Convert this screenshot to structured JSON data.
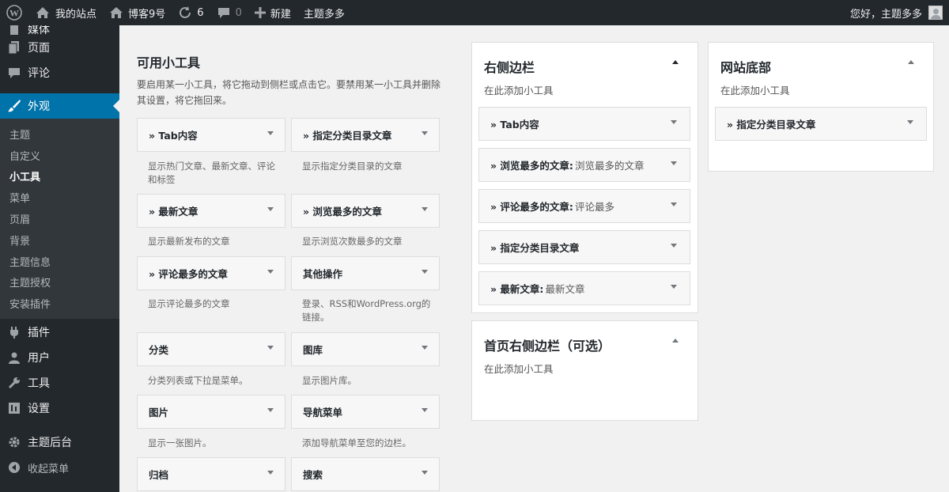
{
  "colors": {
    "adminbar": "#23282d",
    "menu_active": "#0073aa",
    "submenu_bg": "#32373c",
    "page_bg": "#f1f1f1"
  },
  "adminbar": {
    "wp_logo_icon": "wordpress-icon",
    "site_icon": "my-sites-icon",
    "site_label": "我的站点",
    "blog_icon": "home-icon",
    "blog_label": "博客9号",
    "updates_icon": "refresh-icon",
    "updates_count": "6",
    "comments_icon": "comment-icon",
    "comments_count": "0",
    "new_icon": "plus-icon",
    "new_label": "新建",
    "theme_label": "主题多多",
    "greeting": "您好，主题多多",
    "avatar_icon": "avatar-icon"
  },
  "menu": {
    "top_partial": "媒体",
    "pages": "页面",
    "comments": "评论",
    "appearance": "外观",
    "submenu": [
      "主题",
      "自定义",
      "小工具",
      "菜单",
      "页眉",
      "背景",
      "主题信息",
      "主题授权",
      "安装插件"
    ],
    "plugins": "插件",
    "users": "用户",
    "tools": "工具",
    "settings": "设置",
    "theme_admin": "主题后台",
    "collapse": "收起菜单"
  },
  "available": {
    "title": "可用小工具",
    "description": "要启用某一小工具，将它拖动到侧栏或点击它。要禁用某一小工具并删除其设置，将它拖回来。",
    "widgets": [
      {
        "title": "» Tab内容",
        "desc": "显示热门文章、最新文章、评论和标签"
      },
      {
        "title": "» 指定分类目录文章",
        "desc": "显示指定分类目录的文章"
      },
      {
        "title": "» 最新文章",
        "desc": "显示最新发布的文章"
      },
      {
        "title": "» 浏览最多的文章",
        "desc": "显示浏览次数最多的文章"
      },
      {
        "title": "» 评论最多的文章",
        "desc": "显示评论最多的文章"
      },
      {
        "title": "其他操作",
        "desc": "登录、RSS和WordPress.org的链接。"
      },
      {
        "title": "分类",
        "desc": "分类列表或下拉是菜单。"
      },
      {
        "title": "图库",
        "desc": "显示图片库。"
      },
      {
        "title": "图片",
        "desc": "显示一张图片。"
      },
      {
        "title": "导航菜单",
        "desc": "添加导航菜单至您的边栏。"
      },
      {
        "title": "归档",
        "desc": ""
      },
      {
        "title": "搜索",
        "desc": ""
      }
    ]
  },
  "right_sidebar": {
    "title": "右侧边栏",
    "description": "在此添加小工具",
    "widgets": [
      {
        "title": "» Tab内容",
        "subtitle": ""
      },
      {
        "title": "» 浏览最多的文章:",
        "subtitle": "浏览最多的文章"
      },
      {
        "title": "» 评论最多的文章:",
        "subtitle": "评论最多"
      },
      {
        "title": "» 指定分类目录文章",
        "subtitle": ""
      },
      {
        "title": "» 最新文章:",
        "subtitle": "最新文章"
      }
    ]
  },
  "home_sidebar": {
    "title": "首页右侧边栏（可选）",
    "description": "在此添加小工具"
  },
  "footer_sidebar": {
    "title": "网站底部",
    "description": "在此添加小工具",
    "widgets": [
      {
        "title": "» 指定分类目录文章",
        "subtitle": ""
      }
    ]
  }
}
